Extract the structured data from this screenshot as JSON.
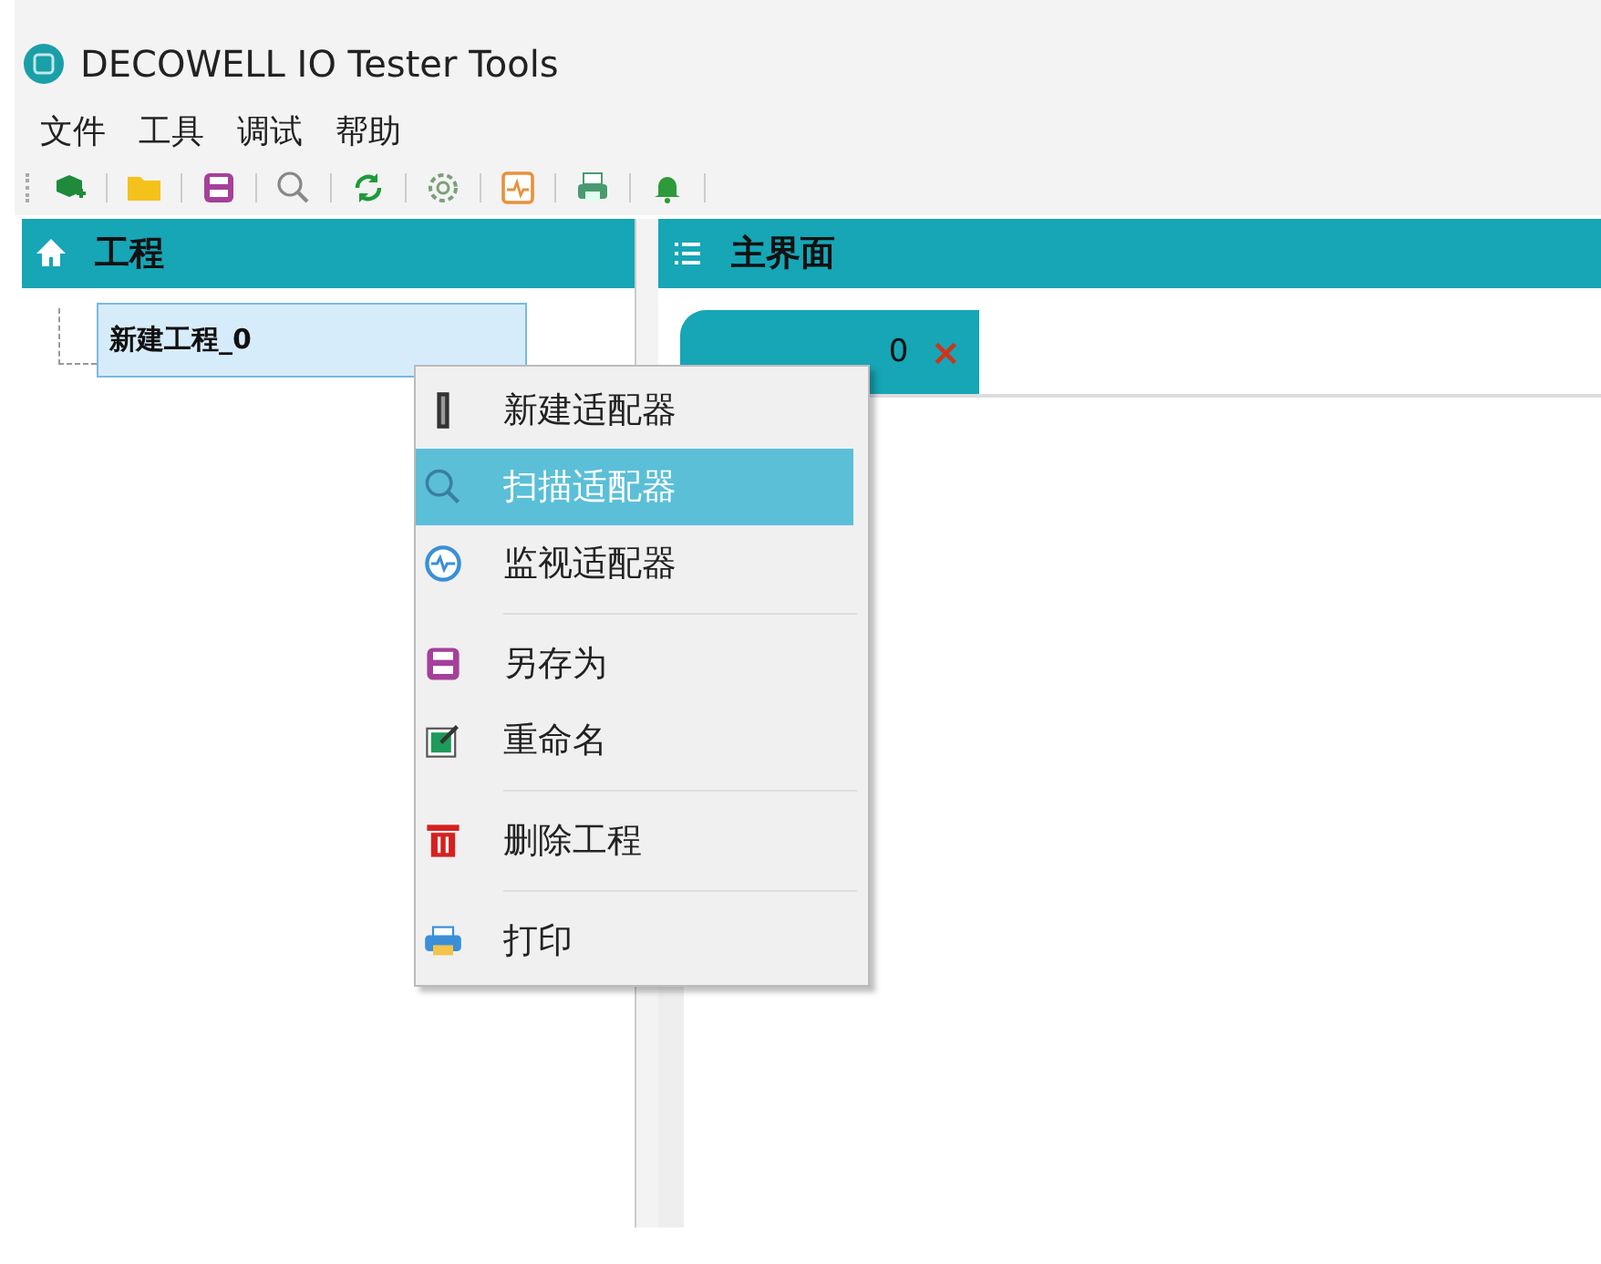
{
  "window": {
    "title": "DECOWELL IO Tester Tools"
  },
  "menu_bar": [
    "文件",
    "工具",
    "调试",
    "帮助"
  ],
  "project_panel": {
    "title": "工程",
    "tree": [
      {
        "label": "新建工程_0",
        "selected": true
      }
    ]
  },
  "main_panel": {
    "title": "主界面",
    "tabs": [
      {
        "label": "0",
        "close": "×",
        "selected": true
      }
    ]
  },
  "context_menu": {
    "groups": [
      [
        {
          "label": "新建适配器",
          "selected": false
        },
        {
          "label": "扫描适配器",
          "selected": true
        },
        {
          "label": "监视适配器",
          "selected": false
        }
      ],
      [
        {
          "label": "另存为",
          "selected": false
        },
        {
          "label": "重命名",
          "selected": false
        }
      ],
      [
        {
          "label": "删除工程",
          "selected": false
        }
      ],
      [
        {
          "label": "打印",
          "selected": false
        }
      ]
    ]
  }
}
